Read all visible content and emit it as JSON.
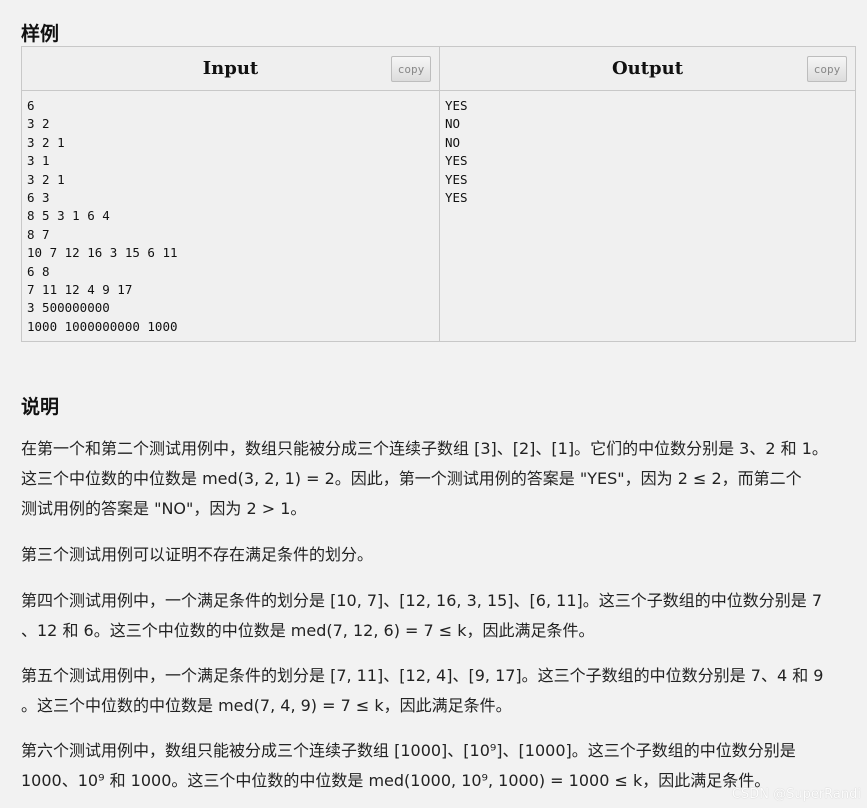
{
  "sample": {
    "title": "样例",
    "input_label": "Input",
    "output_label": "Output",
    "copy_label": "copy",
    "input_lines": [
      "6",
      "3 2",
      "3 2 1",
      "3 1",
      "3 2 1",
      "6 3",
      "8 5 3 1 6 4",
      "8 7",
      "10 7 12 16 3 15 6 11",
      "6 8",
      "7 11 12 4 9 17",
      "3 500000000",
      "1000 1000000000 1000"
    ],
    "output_lines": [
      "YES",
      "NO",
      "NO",
      "YES",
      "YES",
      "YES"
    ]
  },
  "note": {
    "title": "说明",
    "paragraphs": [
      {
        "lines": [
          "在第一个和第二个测试用例中，数组只能被分成三个连续子数组 [3]、[2]、[1]。它们的中位数分别是 3、2 和 1。",
          "这三个中位数的中位数是 med(3, 2, 1) = 2。因此，第一个测试用例的答案是 \"YES\"，因为 2 ≤ 2，而第二个",
          "测试用例的答案是 \"NO\"，因为 2 > 1。"
        ]
      },
      {
        "lines": [
          "第三个测试用例可以证明不存在满足条件的划分。"
        ]
      },
      {
        "lines": [
          "第四个测试用例中，一个满足条件的划分是 [10, 7]、[12, 16, 3, 15]、[6, 11]。这三个子数组的中位数分别是 7",
          "、12 和 6。这三个中位数的中位数是 med(7, 12, 6) = 7 ≤ k，因此满足条件。"
        ]
      },
      {
        "lines": [
          "第五个测试用例中，一个满足条件的划分是 [7, 11]、[12, 4]、[9, 17]。这三个子数组的中位数分别是 7、4 和 9",
          "。这三个中位数的中位数是 med(7, 4, 9) = 7 ≤ k，因此满足条件。"
        ]
      },
      {
        "lines": [
          "第六个测试用例中，数组只能被分成三个连续子数组 [1000]、[10⁹]、[1000]。这三个子数组的中位数分别是",
          "1000、10⁹ 和 1000。这三个中位数的中位数是 med(1000, 10⁹, 1000) = 1000 ≤ k，因此满足条件。"
        ]
      }
    ]
  },
  "watermark": "CSDN @SuperRandi"
}
